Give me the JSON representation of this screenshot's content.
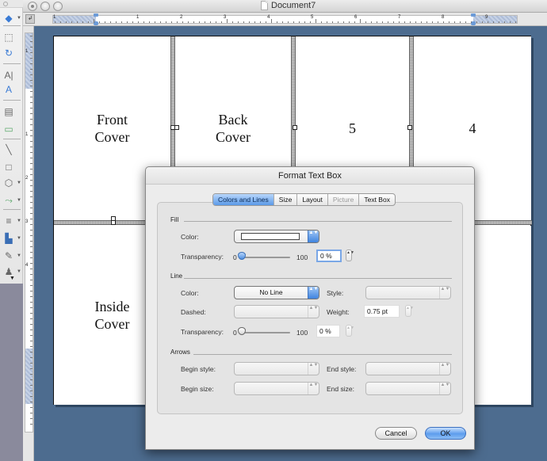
{
  "window": {
    "title": "Document7"
  },
  "toolbox": {
    "tools": [
      {
        "name": "object-palette-icon",
        "has_menu": true
      },
      {
        "name": "select-objects-icon",
        "has_menu": false
      },
      {
        "name": "rotate-icon",
        "has_menu": false
      },
      {
        "name": "text-box-icon",
        "has_menu": false
      },
      {
        "name": "wordart-icon",
        "has_menu": false
      },
      {
        "name": "insert-picture-icon",
        "has_menu": false
      },
      {
        "name": "insert-image-icon",
        "has_menu": false
      },
      {
        "name": "line-icon",
        "has_menu": false
      },
      {
        "name": "rectangle-icon",
        "has_menu": false
      },
      {
        "name": "shapes-icon",
        "has_menu": true
      },
      {
        "name": "connector-icon",
        "has_menu": true
      },
      {
        "name": "line-style-icon",
        "has_menu": true
      },
      {
        "name": "fill-color-icon",
        "has_menu": true
      },
      {
        "name": "line-color-icon",
        "has_menu": true
      },
      {
        "name": "font-color-icon",
        "has_menu": true
      }
    ],
    "more_glyph": "▼"
  },
  "ruler": {
    "corner_glyph": "↲",
    "h_numbers": [
      "1",
      "1",
      "2",
      "3",
      "4",
      "5",
      "6",
      "7",
      "8",
      "9"
    ],
    "v_numbers": [
      "1",
      "1",
      "2",
      "3",
      "4"
    ]
  },
  "document": {
    "panels": [
      {
        "id": "front-cover",
        "text": "Front\nCover"
      },
      {
        "id": "back-cover",
        "text": "Back\nCover"
      },
      {
        "id": "page-5",
        "text": "5"
      },
      {
        "id": "page-4",
        "text": "4"
      },
      {
        "id": "inside-cover",
        "text": "Inside\nCover"
      },
      {
        "id": "panel-2",
        "text": ""
      },
      {
        "id": "panel-3",
        "text": ""
      },
      {
        "id": "panel-6",
        "text": ""
      }
    ]
  },
  "dialog": {
    "title": "Format Text Box",
    "tabs": [
      {
        "label": "Colors and Lines",
        "state": "active"
      },
      {
        "label": "Size",
        "state": "normal"
      },
      {
        "label": "Layout",
        "state": "normal"
      },
      {
        "label": "Picture",
        "state": "disabled"
      },
      {
        "label": "Text Box",
        "state": "normal"
      }
    ],
    "fill": {
      "section": "Fill",
      "color_label": "Color:",
      "color_value": "#ffffff",
      "transparency_label": "Transparency:",
      "slider_min": "0",
      "slider_max": "100",
      "transparency_percent": 0,
      "transparency_value": "0 %"
    },
    "line": {
      "section": "Line",
      "color_label": "Color:",
      "color_value": "No Line",
      "style_label": "Style:",
      "style_value": "",
      "dashed_label": "Dashed:",
      "dashed_value": "",
      "weight_label": "Weight:",
      "weight_value": "0.75 pt",
      "transparency_label": "Transparency:",
      "slider_min": "0",
      "slider_max": "100",
      "transparency_percent": 0,
      "transparency_value": "0 %"
    },
    "arrows": {
      "section": "Arrows",
      "begin_style_label": "Begin style:",
      "begin_style_value": "",
      "end_style_label": "End style:",
      "end_style_value": "",
      "begin_size_label": "Begin size:",
      "begin_size_value": "",
      "end_size_label": "End size:",
      "end_size_value": ""
    },
    "buttons": {
      "cancel": "Cancel",
      "ok": "OK"
    },
    "stepper_glyph": "▲▼"
  },
  "colors": {
    "accent": "#5b9ae8",
    "canvas": "#4d6c8f"
  }
}
